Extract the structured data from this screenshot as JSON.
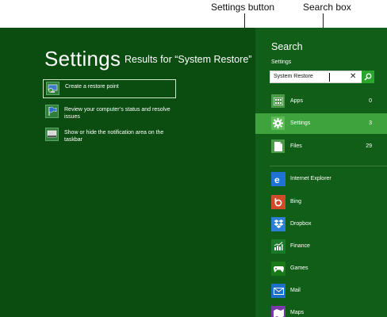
{
  "callouts": {
    "settings_button": "Settings button",
    "search_box": "Search box"
  },
  "main": {
    "title": "Settings",
    "results_for": "Results for “System Restore”",
    "results": [
      {
        "label": "Create a restore point",
        "icon": "restore-point-icon",
        "selected": true
      },
      {
        "label": "Review your computer’s status and resolve issues",
        "icon": "action-center-flag-icon",
        "selected": false
      },
      {
        "label": "Show or hide the notification area on the taskbar",
        "icon": "taskbar-icon",
        "selected": false
      }
    ]
  },
  "search_pane": {
    "title": "Search",
    "scope_label": "Settings",
    "query": "System Restore",
    "categories": [
      {
        "label": "Apps",
        "count": "0",
        "icon": "apps-grid-icon"
      },
      {
        "label": "Settings",
        "count": "3",
        "icon": "gear-icon",
        "active": true
      },
      {
        "label": "Files",
        "count": "29",
        "icon": "file-icon"
      }
    ],
    "apps": [
      {
        "label": "Internet Explorer",
        "icon": "internet-explorer-icon",
        "color": "#1f73d6"
      },
      {
        "label": "Bing",
        "icon": "bing-icon",
        "color": "#d14a2a"
      },
      {
        "label": "Dropbox",
        "icon": "dropbox-icon",
        "color": "#2b7fd4"
      },
      {
        "label": "Finance",
        "icon": "finance-chart-icon",
        "color": "#1a7a2a"
      },
      {
        "label": "Games",
        "icon": "game-controller-icon",
        "color": "#1a7a1a"
      },
      {
        "label": "Mail",
        "icon": "mail-icon",
        "color": "#1d6fc9"
      },
      {
        "label": "Maps",
        "icon": "maps-icon",
        "color": "#7a3aa8"
      }
    ]
  },
  "colors": {
    "background": "#0b4c10",
    "pane": "#105e17",
    "active_category": "#3ea33c"
  }
}
